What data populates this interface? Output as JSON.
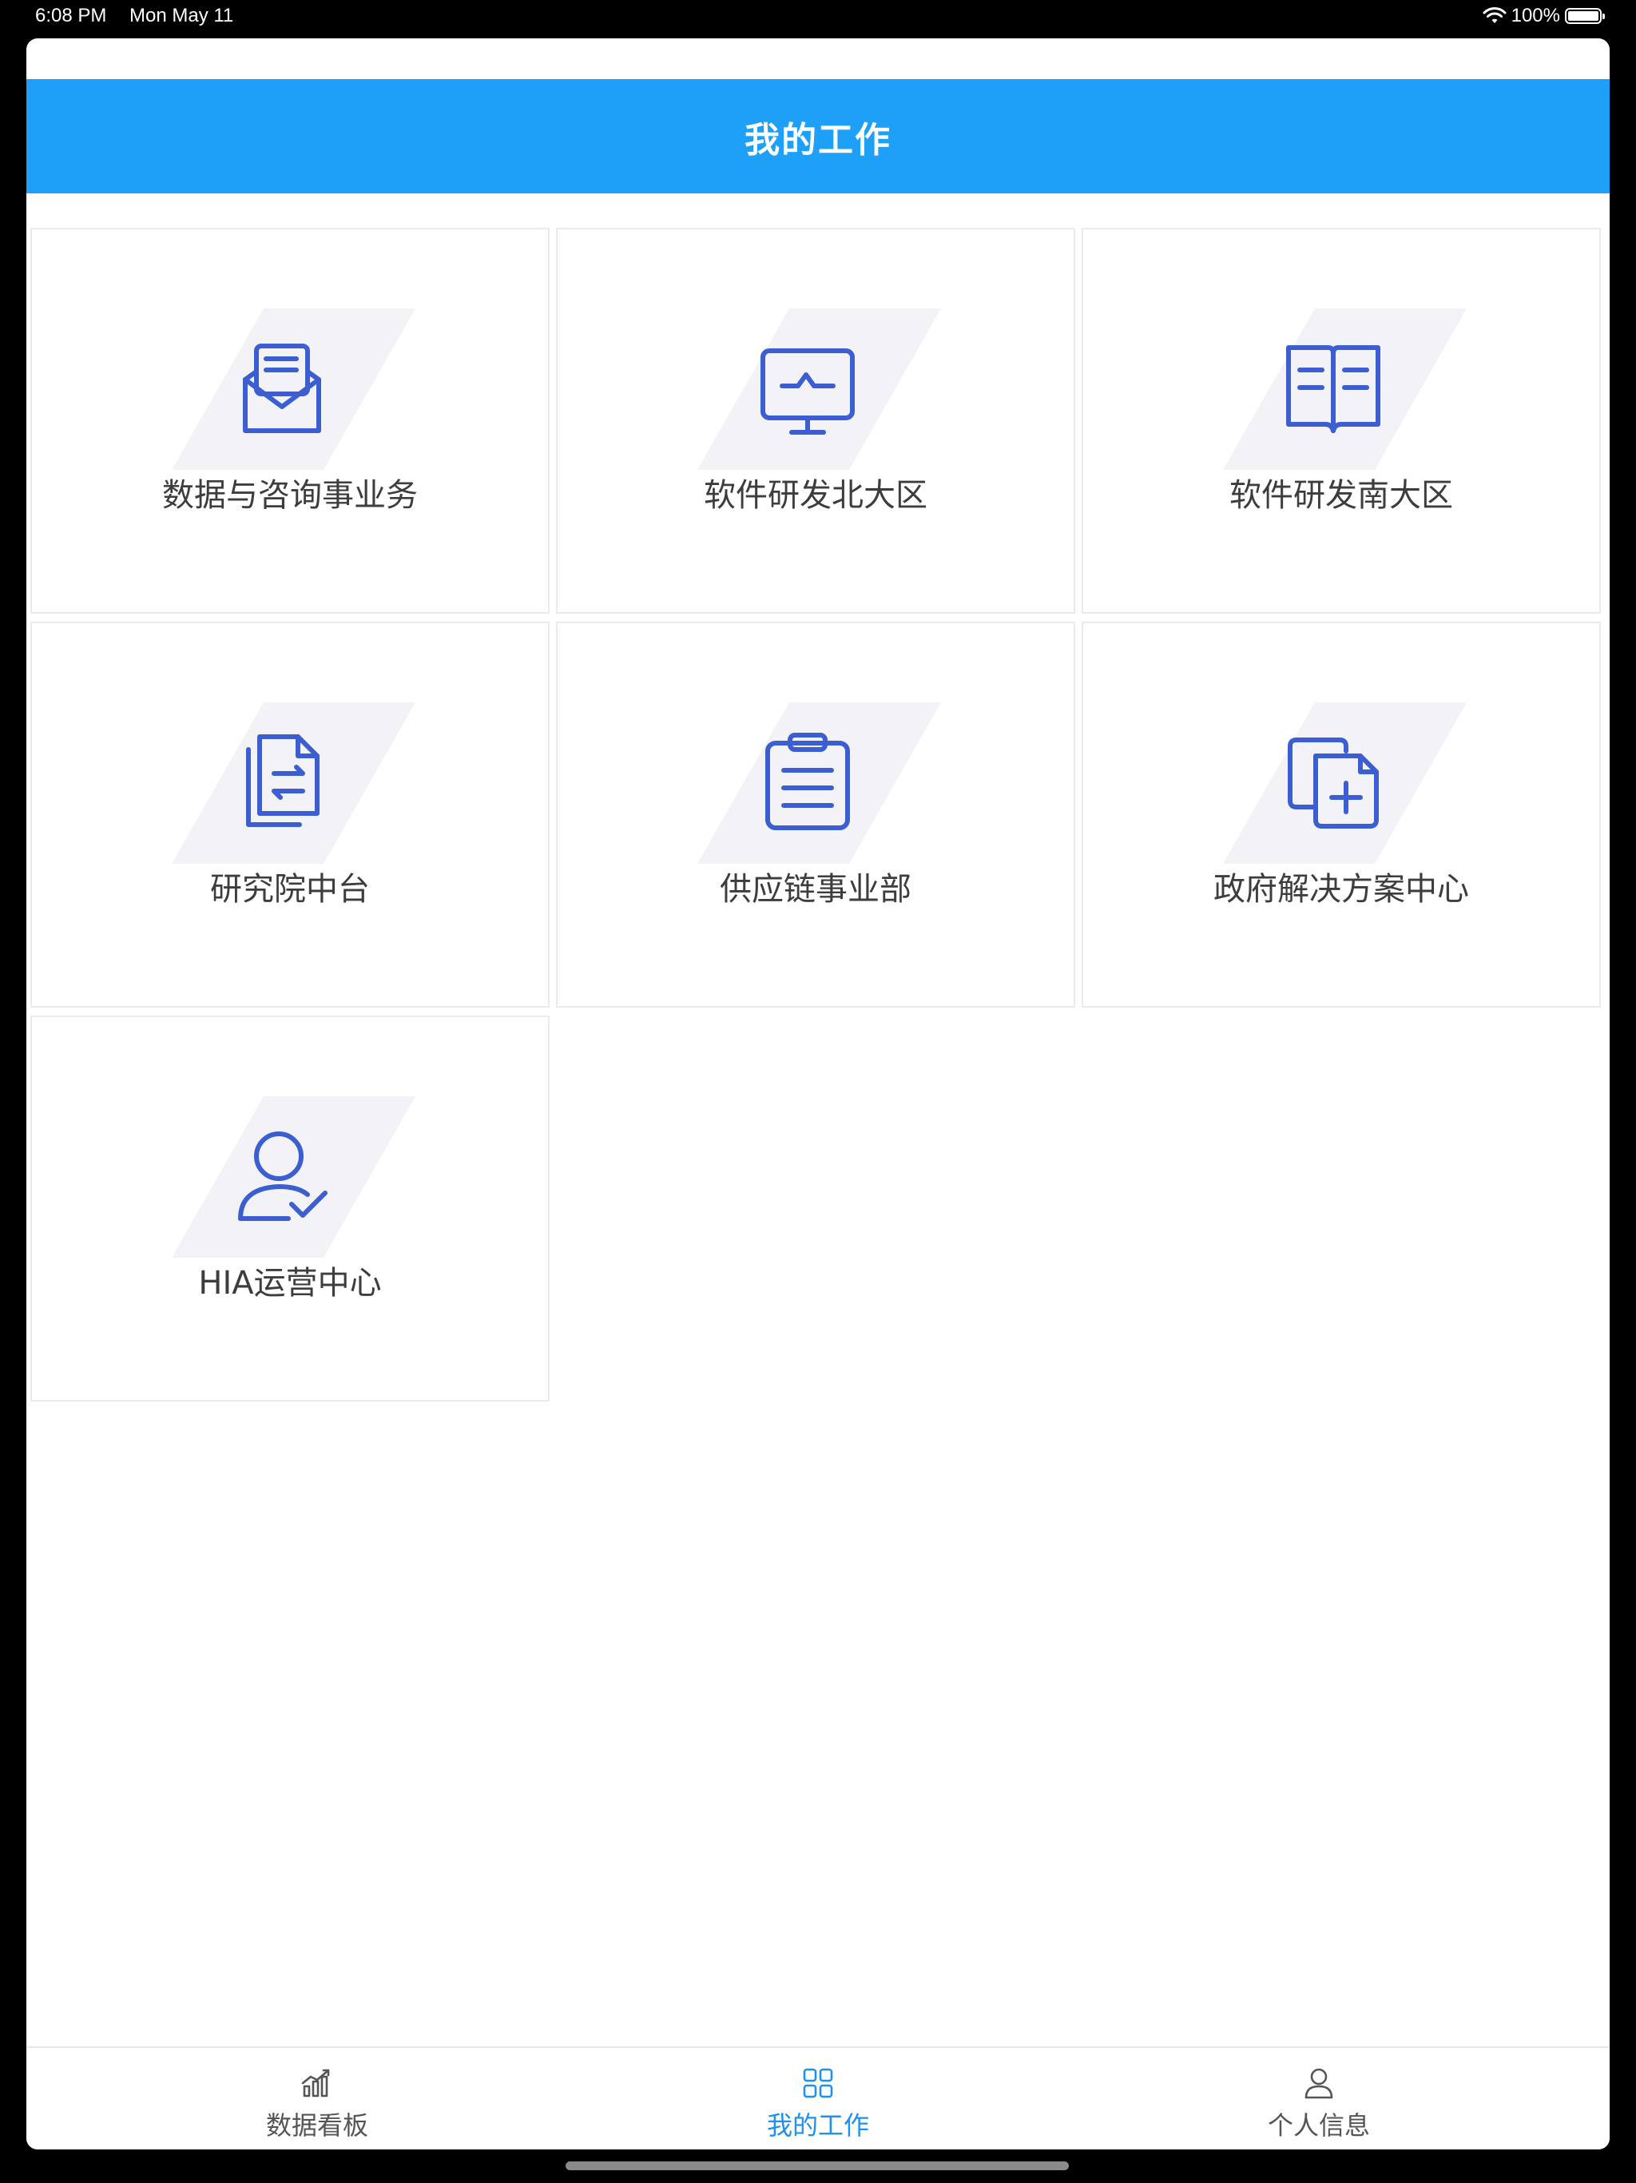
{
  "status_bar": {
    "time": "6:08 PM",
    "date": "Mon May 11",
    "battery": "100%",
    "battery_level": 1.0
  },
  "header": {
    "title": "我的工作"
  },
  "cards": [
    {
      "label": "数据与咨询事业务",
      "icon": "envelope-letter-icon"
    },
    {
      "label": "软件研发北大区",
      "icon": "monitor-pulse-icon"
    },
    {
      "label": "软件研发南大区",
      "icon": "open-book-icon"
    },
    {
      "label": "研究院中台",
      "icon": "document-transfer-icon"
    },
    {
      "label": "供应链事业部",
      "icon": "clipboard-icon"
    },
    {
      "label": "政府解决方案中心",
      "icon": "documents-add-icon"
    },
    {
      "label": "HIA运营中心",
      "icon": "user-check-icon"
    }
  ],
  "tabbar": {
    "tabs": [
      {
        "label": "数据看板",
        "icon": "chart-icon",
        "active": false
      },
      {
        "label": "我的工作",
        "icon": "grid-icon",
        "active": true
      },
      {
        "label": "个人信息",
        "icon": "user-icon",
        "active": false
      }
    ]
  },
  "colors": {
    "header_bg": "#1e9ff8",
    "icon_blue": "#3b5fd0",
    "icon_bg": "#f2f2f7",
    "active_tab": "#1e90ef",
    "inactive_tab": "#555555"
  }
}
